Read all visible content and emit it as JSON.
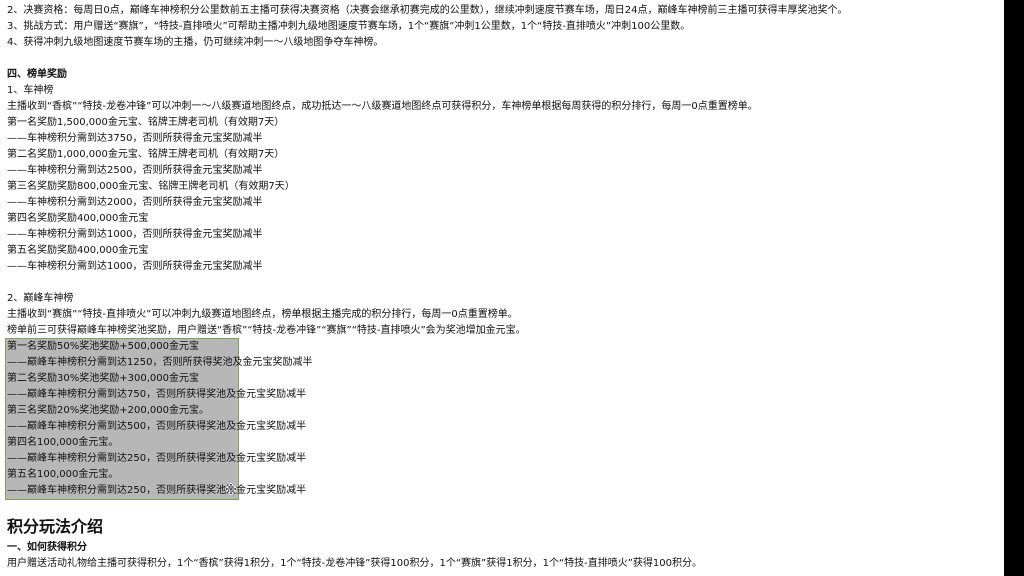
{
  "document": {
    "rules_tail": [
      "2、决赛资格：每周日0点，巅峰车神榜积分公里数前五主播可获得决赛资格（决赛会继承初赛完成的公里数），继续冲刺速度节赛车场，周日24点，巅峰车神榜前三主播可获得丰厚奖池奖个。",
      "3、挑战方式：用户赠送“赛旗”，“特技-直排喷火”可帮助主播冲刺九级地图速度节赛车场，1个“赛旗”冲刺1公里数，1个“特技-直排喷火”冲刺100公里数。",
      "4、获得冲刺九级地图速度节赛车场的主播，仍可继续冲刺一～八级地图争夺车神榜。"
    ],
    "section4_title": "四、榜单奖励",
    "car_god": {
      "heading": "1、车神榜",
      "intro": "主播收到“香槟”“特技-龙卷冲锋”可以冲刺一～八级赛道地图终点，成功抵达一～八级赛道地图终点可获得积分，车神榜单根据每周获得的积分排行，每周一0点重置榜单。",
      "lines": [
        "第一名奖励1,500,000金元宝、铭牌王牌老司机（有效期7天）",
        "——车神榜积分需到达3750，否则所获得金元宝奖励减半",
        "第二名奖励1,000,000金元宝、铭牌王牌老司机（有效期7天）",
        "——车神榜积分需到达2500，否则所获得金元宝奖励减半",
        "第三名奖励奖励800,000金元宝、铭牌王牌老司机（有效期7天）",
        "——车神榜积分需到达2000，否则所获得金元宝奖励减半",
        "第四名奖励奖励400,000金元宝",
        "——车神榜积分需到达1000，否则所获得金元宝奖励减半",
        "第五名奖励奖励400,000金元宝",
        "——车神榜积分需到达1000，否则所获得金元宝奖励减半"
      ]
    },
    "peak_god": {
      "heading": "2、巅峰车神榜",
      "intro1": "主播收到“赛旗”“特技-直排喷火”可以冲刺九级赛道地图终点，榜单根据主播完成的积分排行，每周一0点重置榜单。",
      "intro2": "榜单前三可获得巅峰车神榜奖池奖励，用户赠送“香槟”“特技-龙卷冲锋”“赛旗”“特技-直排喷火”会为奖池增加金元宝。",
      "lines": [
        "第一名奖励50%奖池奖励+500,000金元宝",
        "——巅峰车神榜积分需到达1250，否则所获得奖池及金元宝奖励减半",
        "第二名奖励30%奖池奖励+300,000金元宝",
        "——巅峰车神榜积分需到达750，否则所获得奖池及金元宝奖励减半",
        "第三名奖励20%奖池奖励+200,000金元宝。",
        "——巅峰车神榜积分需到达500，否则所获得奖池及金元宝奖励减半",
        "第四名100,000金元宝。",
        "——巅峰车神榜积分需到达250，否则所获得奖池及金元宝奖励减半",
        "第五名100,000金元宝。",
        "——巅峰车神榜积分需到达250，否则所获得奖池及金元宝奖励减半"
      ]
    },
    "points_title": "积分玩法介绍",
    "points_sub": "一、如何获得积分",
    "points_line": "用户赠送活动礼物给主播可获得积分，1个“香槟”获得1积分，1个“特技-龙卷冲锋”获得100积分，1个“赛旗”获得1积分，1个“特技-直排喷火”获得100积分。"
  },
  "colors": {
    "selection": "#b7b7b7",
    "selection_border": "#7aa65c",
    "background": "#ffffff"
  },
  "cursor_icon": "move-cursor-icon"
}
